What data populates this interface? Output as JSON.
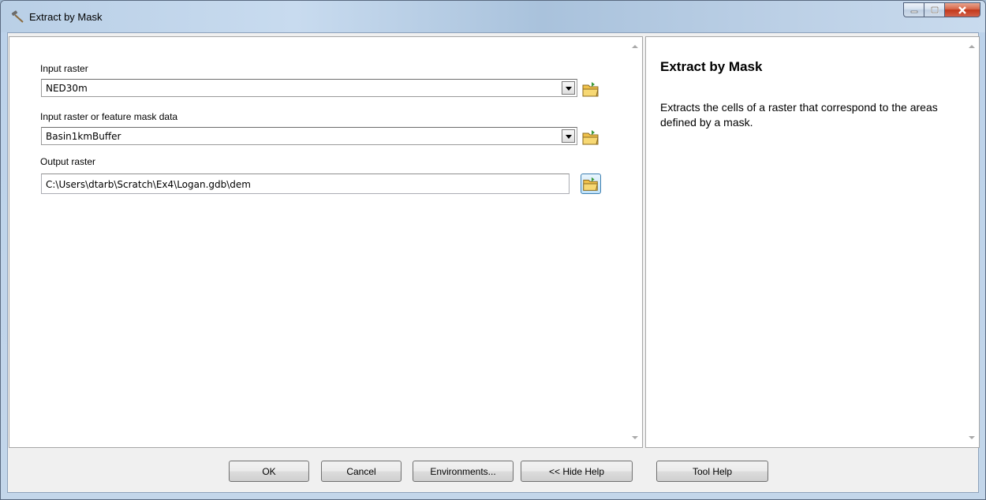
{
  "window": {
    "title": "Extract by Mask",
    "controls": [
      "minimize-icon",
      "maximize-icon",
      "close-icon"
    ]
  },
  "form": {
    "input_raster_label": "Input raster",
    "input_raster_value": "NED30m",
    "mask_label": "Input raster or feature mask data",
    "mask_value": "Basin1kmBuffer",
    "output_label": "Output raster",
    "output_value": "C:\\Users\\dtarb\\Scratch\\Ex4\\Logan.gdb\\dem"
  },
  "help": {
    "title": "Extract by Mask",
    "text": "Extracts the cells of a raster that correspond to the areas defined by a mask."
  },
  "buttons": {
    "ok": "OK",
    "cancel": "Cancel",
    "environments": "Environments...",
    "hide_help": "<< Hide Help",
    "tool_help": "Tool Help"
  },
  "colors": {
    "title_bar": "#bcd2ea",
    "close_button": "#c2381a",
    "folder_icon": "#f0c14b"
  }
}
